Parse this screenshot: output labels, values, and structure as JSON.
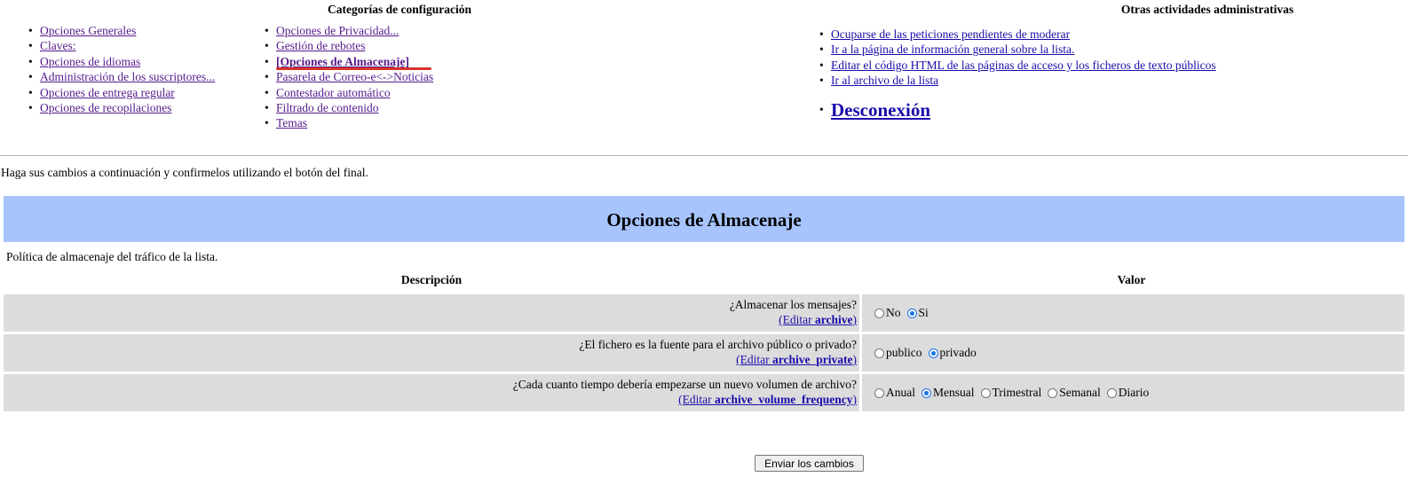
{
  "config": {
    "title": "Categorías de configuración",
    "col1": [
      {
        "label": "Opciones Generales"
      },
      {
        "label": "Claves:"
      },
      {
        "label": "Opciones de idiomas"
      },
      {
        "label": "Administración de los suscriptores..."
      },
      {
        "label": "Opciones de entrega regular"
      },
      {
        "label": "Opciones de recopilaciones"
      }
    ],
    "col2": [
      {
        "label": "Opciones de Privacidad..."
      },
      {
        "label": "Gestión de rebotes"
      },
      {
        "label": "[Opciones de Almacenaje]"
      },
      {
        "label": "Pasarela de Correo-e<->Noticias"
      },
      {
        "label": "Contestador automático"
      },
      {
        "label": "Filtrado de contenido"
      },
      {
        "label": "Temas"
      }
    ]
  },
  "admin": {
    "title": "Otras actividades administrativas",
    "links": [
      {
        "label": "Ocuparse de las peticiones pendientes de moderar"
      },
      {
        "label": "Ir a la página de información general sobre la lista."
      },
      {
        "label": "Editar el código HTML de las páginas de acceso y los ficheros de texto públicos"
      },
      {
        "label": "Ir al archivo de la lista"
      }
    ],
    "logout": "Desconexión"
  },
  "intro": "Haga sus cambios a continuación y confirmelos utilizando el botón del final.",
  "section": {
    "title": "Opciones de Almacenaje",
    "description": "Política de almacenaje del tráfico de la lista."
  },
  "table": {
    "col_desc": "Descripción",
    "col_value": "Valor",
    "rows": [
      {
        "question": "¿Almacenar los mensajes?",
        "edit_prefix": "(Editar ",
        "edit_var": "archive",
        "edit_suffix": ")",
        "options": [
          {
            "label": "No",
            "selected": false
          },
          {
            "label": "Si",
            "selected": true
          }
        ]
      },
      {
        "question": "¿El fichero es la fuente para el archivo público o privado?",
        "edit_prefix": "(Editar ",
        "edit_var": "archive_private",
        "edit_suffix": ")",
        "options": [
          {
            "label": "publico",
            "selected": false
          },
          {
            "label": "privado",
            "selected": true
          }
        ]
      },
      {
        "question": "¿Cada cuanto tiempo debería empezarse un nuevo volumen de archivo?",
        "edit_prefix": "(Editar ",
        "edit_var": "archive_volume_frequency",
        "edit_suffix": ")",
        "options": [
          {
            "label": "Anual",
            "selected": false
          },
          {
            "label": "Mensual",
            "selected": true
          },
          {
            "label": "Trimestral",
            "selected": false
          },
          {
            "label": "Semanal",
            "selected": false
          },
          {
            "label": "Diario",
            "selected": false
          }
        ]
      }
    ]
  },
  "submit_label": "Enviar los cambios",
  "colors": {
    "banner": "#a7c4ff",
    "row": "#dcdcdc",
    "highlight": "#d9322b",
    "link": "#1a0dab",
    "visited": "#551a8b"
  }
}
